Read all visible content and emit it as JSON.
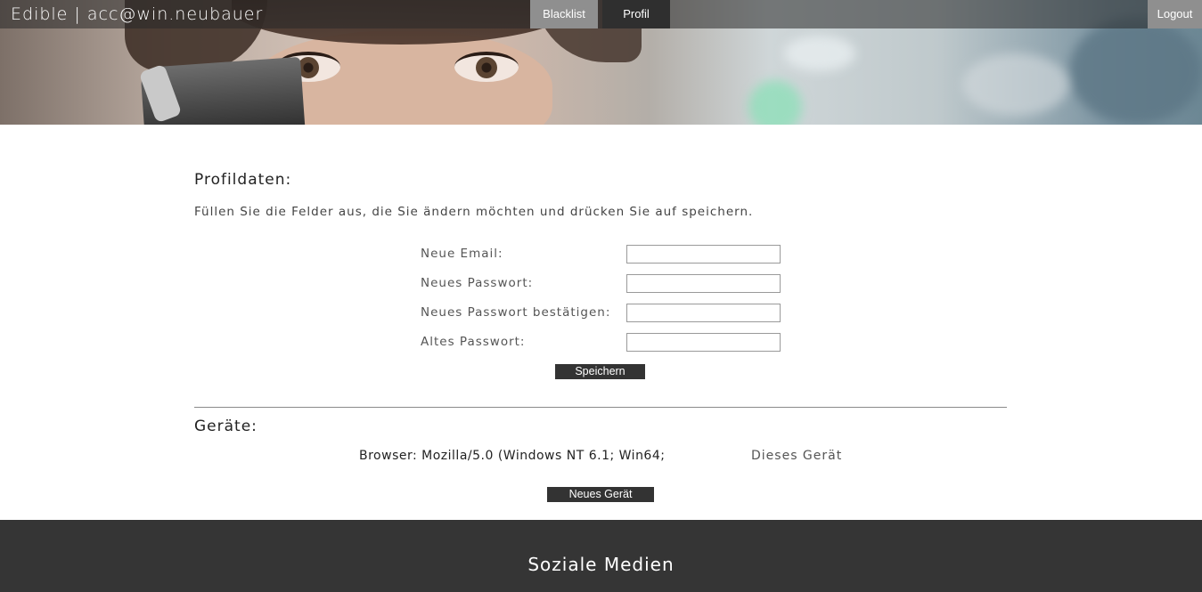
{
  "header": {
    "brand": "Edible | acc@win.neubauer",
    "nav": {
      "blacklist": "Blacklist",
      "profil": "Profil",
      "logout": "Logout"
    }
  },
  "profile": {
    "title": "Profildaten:",
    "instruction": "Füllen Sie die Felder aus, die Sie ändern möchten und drücken Sie auf speichern.",
    "fields": [
      {
        "label": "Neue Email:",
        "value": ""
      },
      {
        "label": "Neues Passwort:",
        "value": ""
      },
      {
        "label": "Neues Passwort bestätigen:",
        "value": ""
      },
      {
        "label": "Altes Passwort:",
        "value": ""
      }
    ],
    "save_label": "Speichern"
  },
  "devices": {
    "title": "Geräte:",
    "items": [
      {
        "info": "Browser: Mozilla/5.0 (Windows NT 6.1; Win64;",
        "status": "Dieses Gerät"
      }
    ],
    "new_label": "Neues Gerät"
  },
  "footer": {
    "title": "Soziale Medien"
  }
}
